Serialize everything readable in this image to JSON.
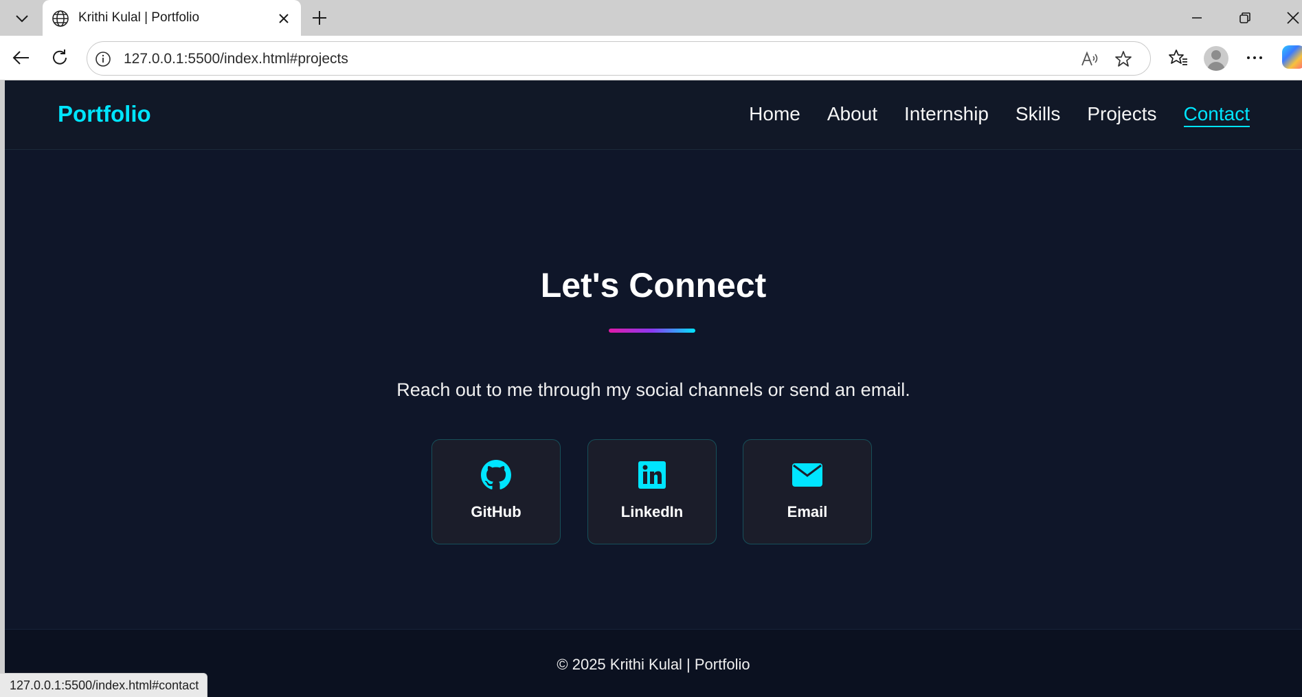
{
  "browser": {
    "tab_title": "Krithi Kulal | Portfolio",
    "url": "127.0.0.1:5500/index.html#projects",
    "status_url": "127.0.0.1:5500/index.html#contact"
  },
  "site": {
    "logo": "Portfolio",
    "nav": {
      "home": "Home",
      "about": "About",
      "internship": "Internship",
      "skills": "Skills",
      "projects": "Projects",
      "contact": "Contact"
    },
    "active_nav": "Contact",
    "accent_color": "#00e5ff",
    "background_color": "#0f1629"
  },
  "contact": {
    "title": "Let's Connect",
    "subtitle": "Reach out to me through my social channels or send an email.",
    "cards": [
      {
        "label": "GitHub",
        "icon": "github-icon"
      },
      {
        "label": "LinkedIn",
        "icon": "linkedin-icon"
      },
      {
        "label": "Email",
        "icon": "envelope-icon"
      }
    ]
  },
  "footer": {
    "text": "© 2025 Krithi Kulal | Portfolio"
  }
}
